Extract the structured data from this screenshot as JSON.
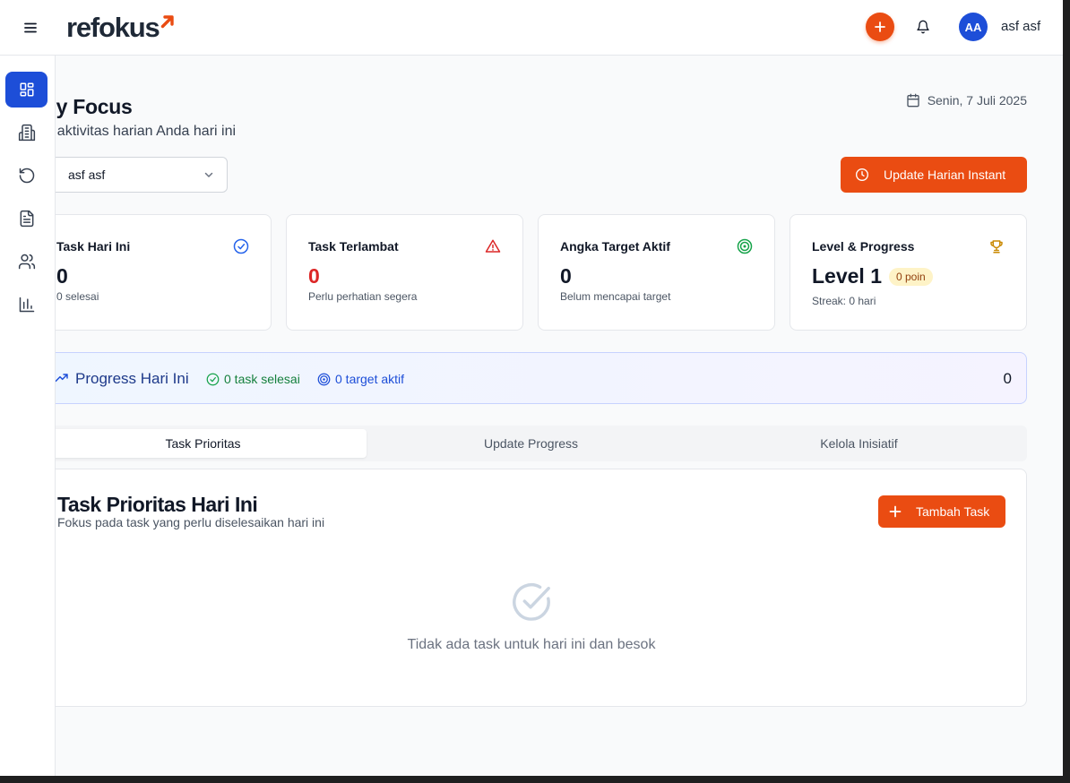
{
  "header": {
    "logo_text": "refokus",
    "user_initials": "AA",
    "user_name": "asf asf"
  },
  "sidebar": {
    "items": [
      {
        "name": "dashboard",
        "icon": "dashboard-icon",
        "active": true
      },
      {
        "name": "building",
        "icon": "building-icon",
        "active": false
      },
      {
        "name": "history",
        "icon": "history-icon",
        "active": false
      },
      {
        "name": "documents",
        "icon": "document-icon",
        "active": false
      },
      {
        "name": "users",
        "icon": "users-icon",
        "active": false
      },
      {
        "name": "analytics",
        "icon": "bar-chart-icon",
        "active": false
      }
    ]
  },
  "page": {
    "title": "aily Focus",
    "subtitle": "ola aktivitas harian Anda hari ini",
    "date": "Senin, 7 Juli 2025"
  },
  "user_select": {
    "value": "asf asf"
  },
  "instant_button": {
    "label": "Update Harian Instant"
  },
  "stats": {
    "today": {
      "title": "Task Hari Ini",
      "value": "0",
      "note": "0 selesai"
    },
    "late": {
      "title": "Task Terlambat",
      "value": "0",
      "note": "Perlu perhatian segera"
    },
    "targets": {
      "title": "Angka Target Aktif",
      "value": "0",
      "note": "Belum mencapai target"
    },
    "level": {
      "title": "Level & Progress",
      "value": "Level 1",
      "points": "0 poin",
      "streak": "Streak: 0 hari"
    }
  },
  "progress": {
    "title": "Progress Hari Ini",
    "done": "0 task selesai",
    "targets": "0 target aktif",
    "count": "0"
  },
  "tabs": [
    {
      "label": "Task Prioritas",
      "active": true
    },
    {
      "label": "Update Progress",
      "active": false
    },
    {
      "label": "Kelola Inisiatif",
      "active": false
    }
  ],
  "panel": {
    "title": "Task Prioritas Hari Ini",
    "subtitle": "Fokus pada task yang perlu diselesaikan hari ini",
    "add_label": "Tambah Task",
    "empty_text": "Tidak ada task untuk hari ini dan besok"
  },
  "colors": {
    "brand_orange": "#ea4c12",
    "primary_blue": "#1d4ed8",
    "danger_red": "#dc2626",
    "success_green": "#16a34a"
  }
}
